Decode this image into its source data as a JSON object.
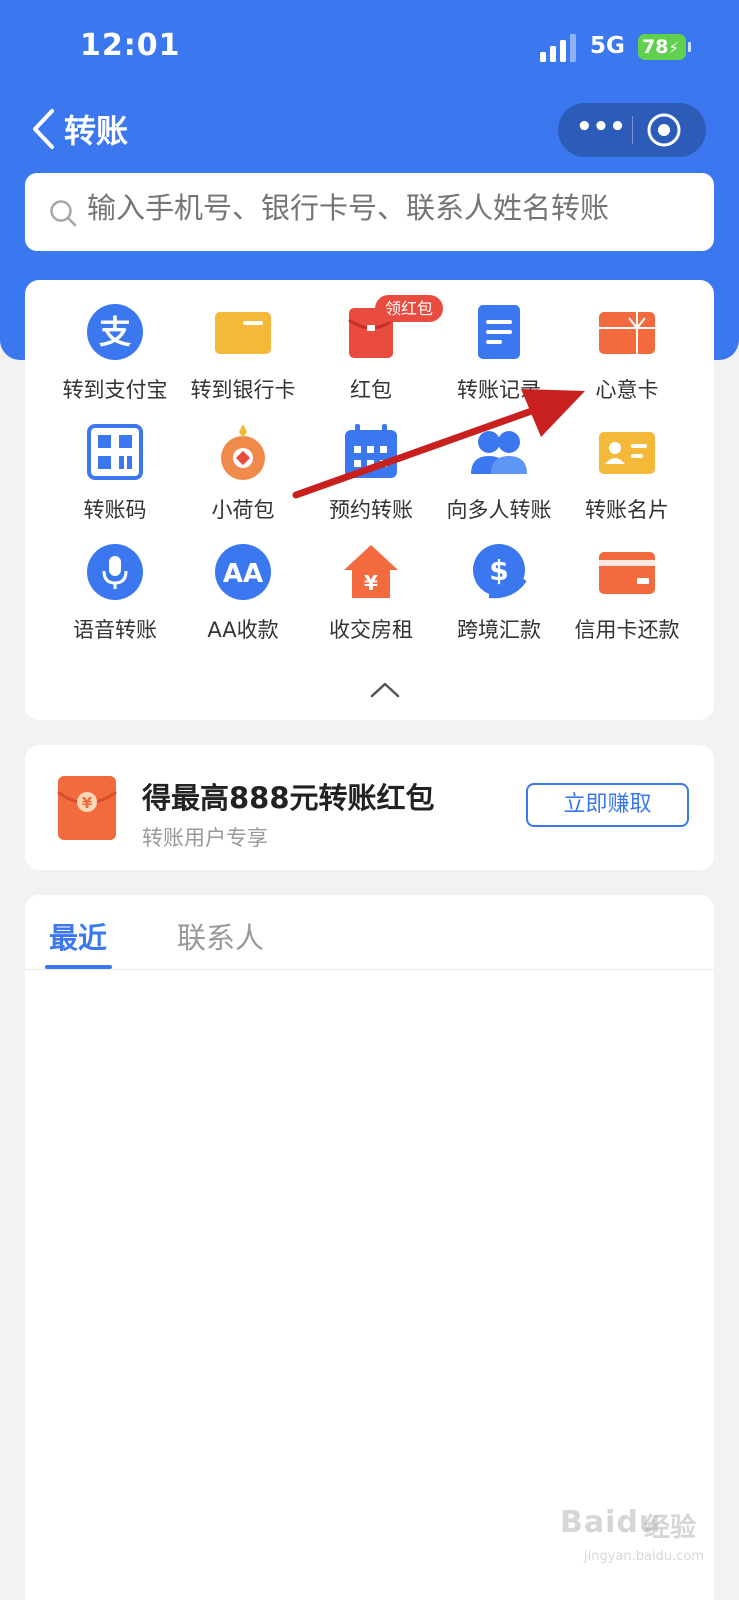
{
  "status_bar": {
    "time": "12:01",
    "network": "5G",
    "battery": "78"
  },
  "nav": {
    "title": "转账"
  },
  "search": {
    "placeholder": "输入手机号、银行卡号、联系人姓名转账"
  },
  "grid": {
    "items": [
      {
        "label": "转到支付宝",
        "icon": "alipay-icon"
      },
      {
        "label": "转到银行卡",
        "icon": "bank-card-icon"
      },
      {
        "label": "红包",
        "icon": "red-packet-icon",
        "badge": "领红包"
      },
      {
        "label": "转账记录",
        "icon": "record-icon"
      },
      {
        "label": "心意卡",
        "icon": "gift-card-icon"
      },
      {
        "label": "转账码",
        "icon": "qr-code-icon"
      },
      {
        "label": "小荷包",
        "icon": "pouch-icon"
      },
      {
        "label": "预约转账",
        "icon": "calendar-icon"
      },
      {
        "label": "向多人转账",
        "icon": "multi-user-icon"
      },
      {
        "label": "转账名片",
        "icon": "business-card-icon"
      },
      {
        "label": "语音转账",
        "icon": "microphone-icon"
      },
      {
        "label": "AA收款",
        "icon": "aa-icon"
      },
      {
        "label": "收交房租",
        "icon": "house-icon"
      },
      {
        "label": "跨境汇款",
        "icon": "dollar-icon"
      },
      {
        "label": "信用卡还款",
        "icon": "credit-card-icon"
      }
    ]
  },
  "promo": {
    "title": "得最高888元转账红包",
    "subtitle": "转账用户专享",
    "button": "立即赚取",
    "currency_symbol": "¥"
  },
  "tabs": [
    {
      "label": "最近",
      "active": true
    },
    {
      "label": "联系人",
      "active": false
    }
  ],
  "watermark": {
    "brand": "Baidu",
    "text": "经验",
    "url": "jingyan.baidu.com"
  },
  "colors": {
    "primary": "#3b78f0",
    "red": "#e94c3f",
    "orange": "#f26a3d",
    "yellow": "#f5b93a",
    "arrow": "#c8201e"
  }
}
